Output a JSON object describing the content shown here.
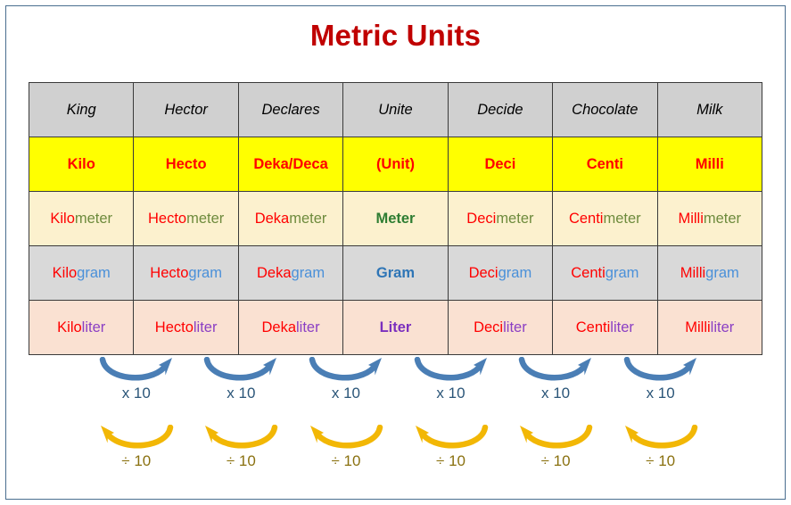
{
  "title": "Metric Units",
  "colors": {
    "title": "#C00000",
    "header_bg": "#D0D0D0",
    "prefix_bg": "#FFFF00",
    "prefix_text": "#FF0000",
    "meter_row_bg": "#FCF1CE",
    "gram_row_bg": "#D9D9D9",
    "liter_row_bg": "#FAE1D2",
    "meter_base": "#6E8B3D",
    "gram_base": "#4A90D9",
    "liter_base": "#8B3FC4",
    "arrow_multiply": "#4A7EB5",
    "arrow_divide": "#F2B705",
    "frame": "#4A6E8F"
  },
  "table": {
    "mnemonic_row": [
      "King",
      "Hector",
      "Declares",
      "Unite",
      "Decide",
      "Chocolate",
      "Milk"
    ],
    "prefix_row": [
      "Kilo",
      "Hecto",
      "Deka/Deca",
      "(Unit)",
      "Deci",
      "Centi",
      "Milli"
    ],
    "meter_row": [
      {
        "prefix": "Kilo",
        "base": "meter",
        "is_base_unit": false
      },
      {
        "prefix": "Hecto",
        "base": "meter",
        "is_base_unit": false
      },
      {
        "prefix": "Deka",
        "base": "meter",
        "is_base_unit": false
      },
      {
        "prefix": "",
        "base": "Meter",
        "is_base_unit": true
      },
      {
        "prefix": "Deci",
        "base": "meter",
        "is_base_unit": false
      },
      {
        "prefix": "Centi",
        "base": "meter",
        "is_base_unit": false
      },
      {
        "prefix": "Milli",
        "base": "meter",
        "is_base_unit": false
      }
    ],
    "gram_row": [
      {
        "prefix": "Kilo",
        "base": "gram",
        "is_base_unit": false
      },
      {
        "prefix": "Hecto",
        "base": "gram",
        "is_base_unit": false
      },
      {
        "prefix": "Deka",
        "base": "gram",
        "is_base_unit": false
      },
      {
        "prefix": "",
        "base": "Gram",
        "is_base_unit": true
      },
      {
        "prefix": "Deci",
        "base": "gram",
        "is_base_unit": false
      },
      {
        "prefix": "Centi",
        "base": "gram",
        "is_base_unit": false
      },
      {
        "prefix": "Milli",
        "base": "gram",
        "is_base_unit": false
      }
    ],
    "liter_row": [
      {
        "prefix": "Kilo",
        "base": "liter",
        "is_base_unit": false
      },
      {
        "prefix": "Hecto",
        "base": "liter",
        "is_base_unit": false
      },
      {
        "prefix": "Deka",
        "base": "liter",
        "is_base_unit": false
      },
      {
        "prefix": "",
        "base": "Liter",
        "is_base_unit": true
      },
      {
        "prefix": "Deci",
        "base": "liter",
        "is_base_unit": false
      },
      {
        "prefix": "Centi",
        "base": "liter",
        "is_base_unit": false
      },
      {
        "prefix": "Milli",
        "base": "liter",
        "is_base_unit": false
      }
    ]
  },
  "arrows": {
    "multiply": {
      "label": "x 10",
      "count": 6,
      "direction": "left-to-right",
      "icon": "curved-arrow-right-icon",
      "color": "#4A7EB5",
      "label_color": "#2A5578"
    },
    "divide": {
      "label": "÷ 10",
      "count": 6,
      "direction": "right-to-left",
      "icon": "curved-arrow-left-icon",
      "color": "#F2B705",
      "label_color": "#8A7110"
    }
  }
}
